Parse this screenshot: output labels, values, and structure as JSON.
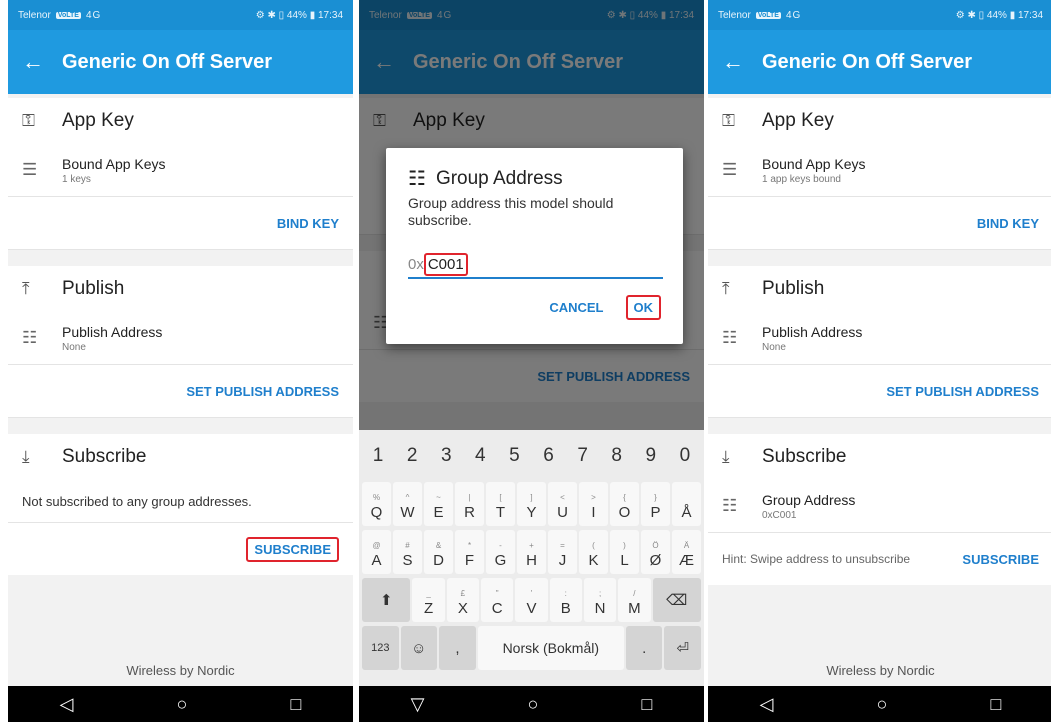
{
  "status": {
    "carrier": "Telenor",
    "volte": "VoLTE",
    "signal": "4G",
    "right": "⚙ ✱ ▯ 44% ▮ 17:34"
  },
  "appbar": {
    "back": "←",
    "title": "Generic On Off Server"
  },
  "app_key": {
    "header": "App Key",
    "bound_title": "Bound App Keys",
    "bind_button": "BIND KEY"
  },
  "screen1": {
    "bound_sub": "1 keys",
    "subscribe_message": "Not subscribed to any group addresses."
  },
  "screen3": {
    "bound_sub": "1 app keys bound",
    "group_title": "Group Address",
    "group_value": "0xC001",
    "hint": "Hint: Swipe address to unsubscribe"
  },
  "publish": {
    "header": "Publish",
    "address_title": "Publish Address",
    "address_value": "None",
    "set_button": "SET PUBLISH ADDRESS"
  },
  "subscribe": {
    "header": "Subscribe",
    "button": "SUBSCRIBE"
  },
  "footer": "Wireless by Nordic",
  "dialog": {
    "title": "Group Address",
    "description": "Group address this model should subscribe.",
    "prefix": "0x",
    "value": "C001",
    "cancel": "CANCEL",
    "ok": "OK"
  },
  "keyboard": {
    "numbers": [
      "1",
      "2",
      "3",
      "4",
      "5",
      "6",
      "7",
      "8",
      "9",
      "0"
    ],
    "row1": [
      [
        "%",
        "Q"
      ],
      [
        "^",
        "W"
      ],
      [
        "~",
        "E"
      ],
      [
        "|",
        "R"
      ],
      [
        "[",
        "T"
      ],
      [
        "]",
        "Y"
      ],
      [
        "<",
        "U"
      ],
      [
        ">",
        "I"
      ],
      [
        "{",
        "O"
      ],
      [
        "}",
        "P"
      ],
      [
        "",
        "Å"
      ]
    ],
    "row2": [
      [
        "@",
        "A"
      ],
      [
        "#",
        "S"
      ],
      [
        "&",
        "D"
      ],
      [
        "*",
        "F"
      ],
      [
        "-",
        "G"
      ],
      [
        "+",
        "H"
      ],
      [
        "=",
        "J"
      ],
      [
        "(",
        "K"
      ],
      [
        ")",
        "L"
      ],
      [
        "Ö",
        "Ø"
      ],
      [
        "Ä",
        "Æ"
      ]
    ],
    "row3": [
      [
        "_",
        "Z"
      ],
      [
        "£",
        "X"
      ],
      [
        "\"",
        "C"
      ],
      [
        "'",
        "V"
      ],
      [
        ":",
        "B"
      ],
      [
        ";",
        "N"
      ],
      [
        "/",
        "M"
      ]
    ],
    "sym": "123",
    "space": "Norsk (Bokmål)",
    "backspace": "⌫",
    "enter": "⏎",
    "shift": "⬆"
  },
  "nav": {
    "back": "◁",
    "home": "○",
    "recents": "□"
  },
  "colors": {
    "primary": "#1f9ae0",
    "accent": "#1f7fcc",
    "highlight": "#e0242d"
  }
}
